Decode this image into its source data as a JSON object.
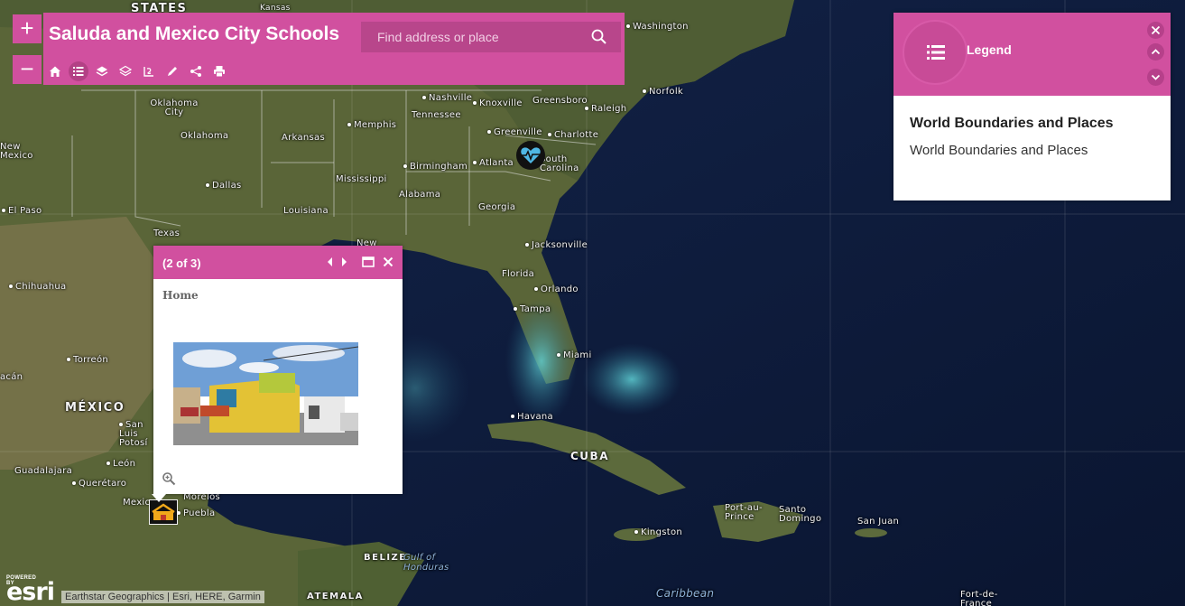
{
  "app": {
    "title": "Saluda and Mexico City Schools",
    "search_placeholder": "Find address or place"
  },
  "zoom": {
    "in_label": "+",
    "out_label": "−"
  },
  "toolbar": {
    "tools": [
      "home-icon",
      "legend-icon",
      "basemap-icon",
      "layers-icon",
      "measure-icon",
      "draw-icon",
      "share-icon",
      "print-icon"
    ],
    "active": "legend-icon"
  },
  "legend": {
    "title": "Legend",
    "layer_title": "World Boundaries and Places",
    "layer_sub": "World Boundaries and Places"
  },
  "popup": {
    "count": "(2 of 3)",
    "title": "Home"
  },
  "attribution": {
    "powered_by": "POWERED BY",
    "brand": "esri",
    "credits": "Earthstar Geographics | Esri, HERE, Garmin"
  },
  "colors": {
    "accent": "#d1509f",
    "accent_dark": "#b8468b",
    "ocean": "#0e1a33",
    "land": "#55613a"
  },
  "map_labels": {
    "states": "STATES",
    "kansas": "Kansas",
    "washington": "Washington",
    "norfolk": "Norfolk",
    "oklahoma_city": "Oklahoma City",
    "oklahoma": "Oklahoma",
    "nashville": "Nashville",
    "knoxville": "Knoxville",
    "greensboro": "Greensboro",
    "raleigh": "Raleigh",
    "tennessee": "Tennessee",
    "memphis": "Memphis",
    "arkansas": "Arkansas",
    "greenville": "Greenville",
    "charlotte": "Charlotte",
    "birmingham": "Birmingham",
    "atlanta": "Atlanta",
    "south_carolina": "South Carolina",
    "new_mexico": "New Mexico",
    "mississippi": "Mississippi",
    "dallas": "Dallas",
    "alabama": "Alabama",
    "el_paso": "El Paso",
    "louisiana": "Louisiana",
    "georgia": "Georgia",
    "texas": "Texas",
    "new_orleans": "New",
    "jacksonville": "Jacksonville",
    "chihuahua": "Chihuahua",
    "florida": "Florida",
    "orlando": "Orlando",
    "tampa": "Tampa",
    "miami": "Miami",
    "torreon": "Torreón",
    "mexico": "MÉXICO",
    "san_luis_potosi": "San Luis Potosí",
    "havana": "Havana",
    "cuba": "CUBA",
    "leon": "León",
    "guadalajara": "Guadalajara",
    "queretaro": "Querétaro",
    "mexico_city": "Mexico",
    "morelos": "Morelos",
    "puebla": "Puebla",
    "belize": "BELIZE",
    "gulf_of_honduras": "Gulf of Honduras",
    "guatemala": "ATEMALA",
    "port_au_prince": "Port-au-Prince",
    "santo_domingo": "Santo Domingo",
    "san_juan": "San Juan",
    "kingston": "Kingston",
    "caribbean": "Caribbean",
    "fort_de_france": "Fort-de-France",
    "sinaloa": "acán"
  }
}
